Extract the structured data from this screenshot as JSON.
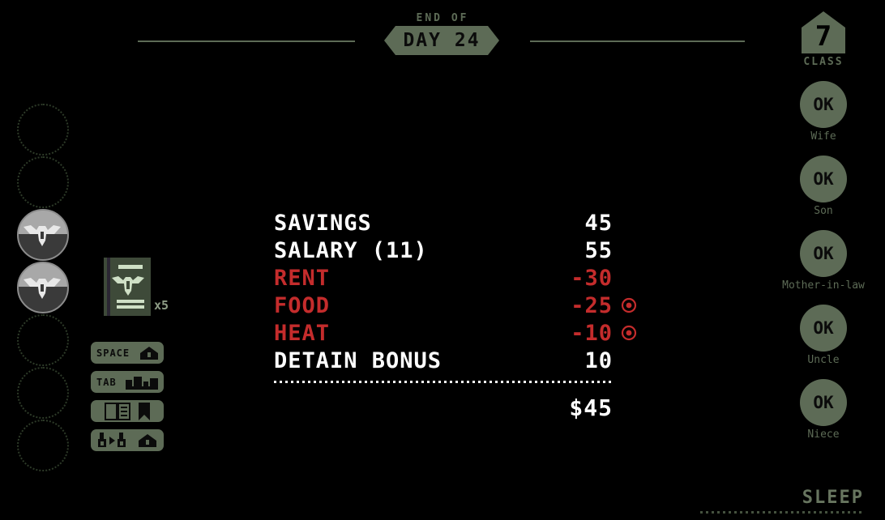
{
  "header": {
    "eyebrow": "END OF",
    "day_title": "DAY 24",
    "banner_color": "#5d6b56"
  },
  "medals": {
    "slots": [
      {
        "name": "medal-slot-1",
        "filled": false
      },
      {
        "name": "medal-slot-2",
        "filled": false
      },
      {
        "name": "medal-slot-3",
        "filled": true
      },
      {
        "name": "medal-slot-4",
        "filled": true
      },
      {
        "name": "medal-slot-5",
        "filled": false
      },
      {
        "name": "medal-slot-6",
        "filled": false
      },
      {
        "name": "medal-slot-7",
        "filled": false
      }
    ]
  },
  "inventory": {
    "item_icon": "passport-icon",
    "count_label": "x5"
  },
  "keybuttons": [
    {
      "label": "SPACE",
      "icons": [
        "booth-icon"
      ]
    },
    {
      "label": "TAB",
      "icons": [
        "city-skyline-icon"
      ]
    },
    {
      "label": "",
      "icons": [
        "rulebook-icon",
        "bookmark-icon"
      ]
    },
    {
      "label": "",
      "icons": [
        "stamp-transfer-icon",
        "booth-icon"
      ]
    }
  ],
  "ledger": {
    "rows": [
      {
        "label": "SAVINGS",
        "value": "45",
        "sign": "pos",
        "marker": false
      },
      {
        "label": "SALARY (11)",
        "value": "55",
        "sign": "pos",
        "marker": false
      },
      {
        "label": "RENT",
        "value": "-30",
        "sign": "neg",
        "marker": false
      },
      {
        "label": "FOOD",
        "value": "-25",
        "sign": "neg",
        "marker": true
      },
      {
        "label": "HEAT",
        "value": "-10",
        "sign": "neg",
        "marker": true
      },
      {
        "label": "DETAIN BONUS",
        "value": "10",
        "sign": "pos",
        "marker": false
      }
    ],
    "total": "$45",
    "positive_color": "#ffffff",
    "negative_color": "#c42c2c",
    "marker_icon": "red-target-icon"
  },
  "rightpanel": {
    "class_number": "7",
    "class_label": "CLASS",
    "family": [
      {
        "name": "Wife",
        "status": "OK"
      },
      {
        "name": "Son",
        "status": "OK"
      },
      {
        "name": "Mother-in-law",
        "status": "OK"
      },
      {
        "name": "Uncle",
        "status": "OK"
      },
      {
        "name": "Niece",
        "status": "OK"
      }
    ]
  },
  "sleep": {
    "label": "SLEEP"
  }
}
